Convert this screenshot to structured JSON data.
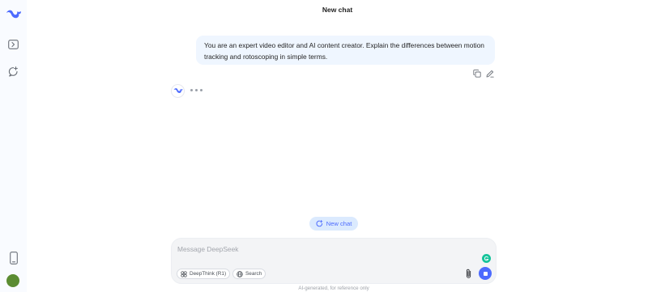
{
  "app": {
    "header_title": "New chat",
    "accent_color": "#4d6bfe",
    "avatar_color": "#5b8c32"
  },
  "sidebar": {
    "icons": [
      "deepseek-logo-icon",
      "open-sidebar-icon",
      "new-chat-icon",
      "mobile-app-icon"
    ]
  },
  "conversation": {
    "user_message": "You are an expert video editor and AI content creator. Explain the differences between motion tracking and rotoscoping in simple terms.",
    "assistant_status": "typing"
  },
  "new_chat_button": {
    "label": "New chat"
  },
  "composer": {
    "placeholder": "Message DeepSeek",
    "value": "",
    "deepthink_label": "DeepThink (R1)",
    "search_label": "Search"
  },
  "footer": {
    "disclaimer": "AI-generated, for reference only"
  }
}
